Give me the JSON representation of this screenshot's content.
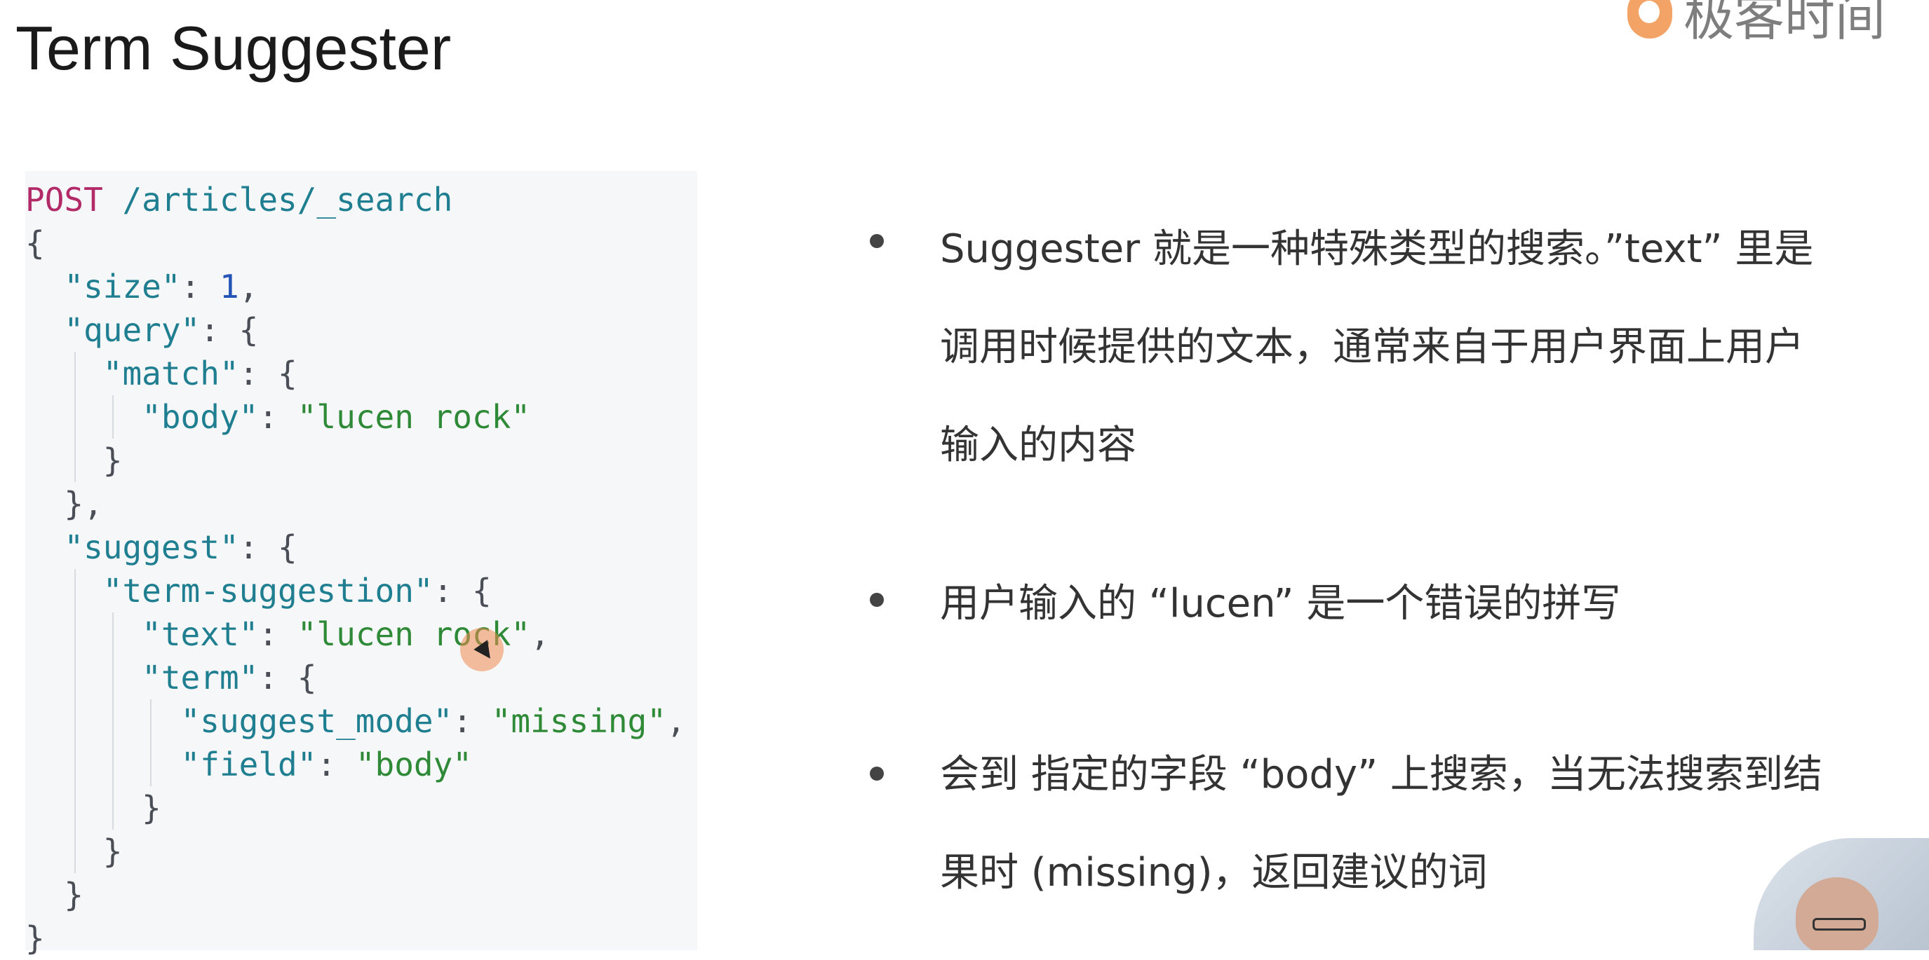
{
  "title": "Term Suggester",
  "brand": {
    "name": "极客时间",
    "accent": "#f08a3c"
  },
  "code_lines": [
    [
      {
        "t": "POST ",
        "c": "m"
      },
      {
        "t": "/articles/_search",
        "c": "k"
      }
    ],
    [
      {
        "t": "{",
        "c": "p"
      }
    ],
    [
      {
        "t": "  "
      },
      {
        "t": "\"size\"",
        "c": "k"
      },
      {
        "t": ": ",
        "c": "p"
      },
      {
        "t": "1",
        "c": "n"
      },
      {
        "t": ",",
        "c": "p"
      }
    ],
    [
      {
        "t": "  "
      },
      {
        "t": "\"query\"",
        "c": "k"
      },
      {
        "t": ": {",
        "c": "p"
      }
    ],
    [
      {
        "t": "    "
      },
      {
        "t": "\"match\"",
        "c": "k"
      },
      {
        "t": ": {",
        "c": "p"
      }
    ],
    [
      {
        "t": "      "
      },
      {
        "t": "\"body\"",
        "c": "k"
      },
      {
        "t": ": ",
        "c": "p"
      },
      {
        "t": "\"lucen rock\"",
        "c": "s"
      }
    ],
    [
      {
        "t": "    }",
        "c": "p"
      }
    ],
    [
      {
        "t": "  },",
        "c": "p"
      }
    ],
    [
      {
        "t": "  "
      },
      {
        "t": "\"suggest\"",
        "c": "k"
      },
      {
        "t": ": {",
        "c": "p"
      }
    ],
    [
      {
        "t": "    "
      },
      {
        "t": "\"term-suggestion\"",
        "c": "k"
      },
      {
        "t": ": {",
        "c": "p"
      }
    ],
    [
      {
        "t": "      "
      },
      {
        "t": "\"text\"",
        "c": "k"
      },
      {
        "t": ": ",
        "c": "p"
      },
      {
        "t": "\"lucen rock\"",
        "c": "s"
      },
      {
        "t": ",",
        "c": "p"
      }
    ],
    [
      {
        "t": "      "
      },
      {
        "t": "\"term\"",
        "c": "k"
      },
      {
        "t": ": {",
        "c": "p"
      }
    ],
    [
      {
        "t": "        "
      },
      {
        "t": "\"suggest_mode\"",
        "c": "k"
      },
      {
        "t": ": ",
        "c": "p"
      },
      {
        "t": "\"missing\"",
        "c": "s"
      },
      {
        "t": ",",
        "c": "p"
      }
    ],
    [
      {
        "t": "        "
      },
      {
        "t": "\"field\"",
        "c": "k"
      },
      {
        "t": ": ",
        "c": "p"
      },
      {
        "t": "\"body\"",
        "c": "s"
      }
    ],
    [
      {
        "t": "      }",
        "c": "p"
      }
    ],
    [
      {
        "t": "    }",
        "c": "p"
      }
    ],
    [
      {
        "t": "  }",
        "c": "p"
      }
    ],
    [
      {
        "t": "}",
        "c": "p"
      }
    ]
  ],
  "bullets": [
    "Suggester 就是一种特殊类型的搜索。”text” 里是\n调用时候提供的文本，通常来自于用户界面上用户\n输入的内容",
    "用户输入的 “lucen” 是一个错误的拼写",
    "会到 指定的字段 “body” 上搜索，当无法搜索到结\n果时 (missing)，返回建议的词"
  ]
}
